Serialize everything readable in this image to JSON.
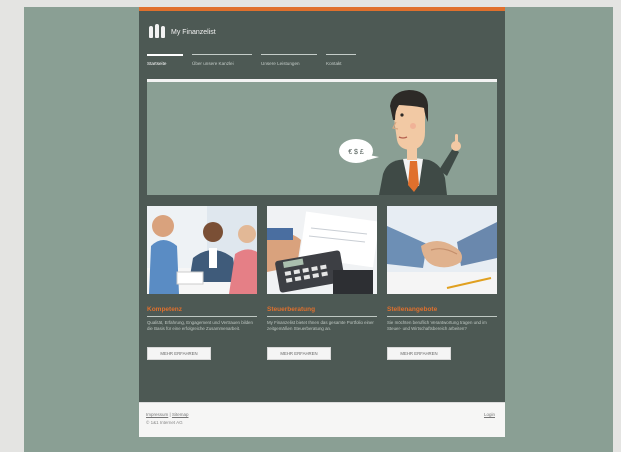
{
  "brand": {
    "name": "My Finanzelist"
  },
  "nav": {
    "items": [
      "Startseite",
      "Über unsere Kanzlei",
      "Unsere Leistungen",
      "Kontakt"
    ]
  },
  "hero": {
    "bubble_text": "€ $ £"
  },
  "cards": [
    {
      "title": "Kompetenz",
      "text": "Qualität, Erfahrung, Engagement und Vertrauen bilden die Basis für eine erfolgreiche Zusammenarbeit.",
      "button": "MEHR ERFAHREN"
    },
    {
      "title": "Steuerberatung",
      "text": "My Finanzelist bietet Ihnen das gesamte Portfolio einer zeitgemäßen Steuerberatung an.",
      "button": "MEHR ERFAHREN"
    },
    {
      "title": "Stellenangebote",
      "text": "Sie möchten beruflich Verantwortung tragen und im Steuer- und Wirtschaftsbereich arbeiten?",
      "button": "MEHR ERFAHREN"
    }
  ],
  "footer": {
    "links": [
      "Impressum",
      "Sitemap"
    ],
    "separator": "|",
    "copyright": "© 1&1 Internet AG",
    "login": "Login"
  },
  "colors": {
    "accent": "#e0702d",
    "page_background": "#4d5954",
    "frame_background": "#8a9f94"
  }
}
